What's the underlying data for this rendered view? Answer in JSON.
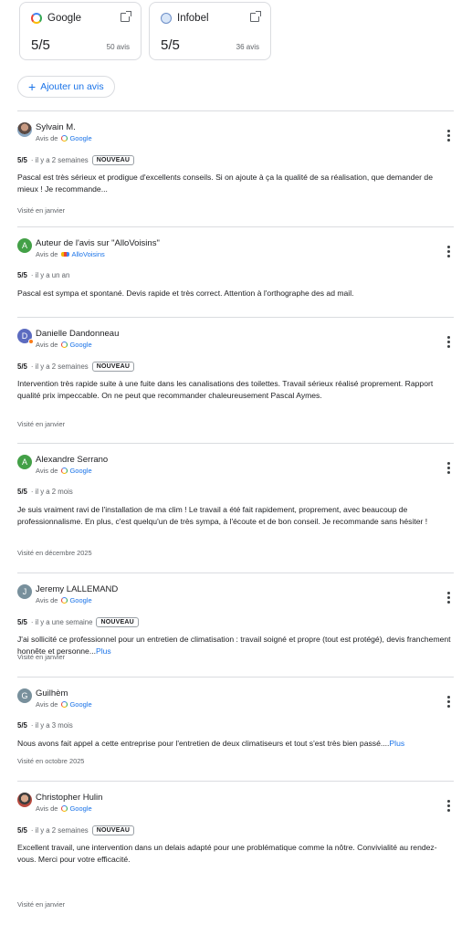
{
  "sources": [
    {
      "name": "Google",
      "logo": "google-logo",
      "score": "5/5",
      "count": "50 avis"
    },
    {
      "name": "Infobel",
      "logo": "infobel-logo",
      "score": "5/5",
      "count": "36 avis"
    }
  ],
  "add_review_label": "Ajouter un avis",
  "reviews": [
    {
      "author": "Sylvain M.",
      "avatar": "photo",
      "source_prefix": "Avis de",
      "source": "Google",
      "score": "5/5",
      "time": "· il y a 2 semaines",
      "tag": "NOUVEAU",
      "text": "Pascal est très sérieux et prodigue d'excellents conseils. Si on ajoute à ça la qualité de sa réalisation, que demander de mieux ! Je recommande...",
      "more": "",
      "visited": "Visité en janvier"
    },
    {
      "author": "Auteur de l'avis sur \"AlloVoisins\"",
      "avatar": "A",
      "avatar_color": "#43a047",
      "source_prefix": "Avis de",
      "source": "AlloVoisins",
      "score": "5/5",
      "time": "· il y a un an",
      "tag": "",
      "text": "Pascal est sympa et spontané. Devis rapide et très correct. Attention à l'orthographe des ad mail.",
      "more": "",
      "visited": ""
    },
    {
      "author": "Danielle Dandonneau",
      "avatar": "D",
      "avatar_color": "#5c6bc0",
      "source_prefix": "Avis de",
      "source": "Google",
      "score": "5/5",
      "time": "· il y a 2 semaines",
      "tag": "NOUVEAU",
      "text": "Intervention très rapide suite à une fuite dans les canalisations des toilettes. Travail sérieux réalisé proprement. Rapport qualité prix impeccable. On ne peut que recommander chaleureusement Pascal Aymes.",
      "more": "",
      "visited": "Visité en janvier"
    },
    {
      "author": "Alexandre Serrano",
      "avatar": "A",
      "avatar_color": "#43a047",
      "source_prefix": "Avis de",
      "source": "Google",
      "score": "5/5",
      "time": "· il y a 2 mois",
      "tag": "",
      "text": "Je suis vraiment ravi de l'installation de ma clim ! Le travail a été fait rapidement, proprement, avec beaucoup de professionnalisme. En plus, c'est quelqu'un de très sympa, à l'écoute et de bon conseil. Je recommande sans hésiter !",
      "more": "",
      "visited": "Visité en décembre 2025"
    },
    {
      "author": "Jeremy LALLEMAND",
      "avatar": "J",
      "avatar_color": "#78909c",
      "source_prefix": "Avis de",
      "source": "Google",
      "score": "5/5",
      "time": "· il y a une semaine",
      "tag": "NOUVEAU",
      "text": "J'ai sollicité ce professionnel pour un entretien de climatisation : travail soigné et propre (tout est protégé), devis franchement honnête et personne...",
      "more": "Plus",
      "visited": "Visité en janvier"
    },
    {
      "author": "Guilhèm",
      "avatar": "G",
      "avatar_color": "#78909c",
      "source_prefix": "Avis de",
      "source": "Google",
      "score": "5/5",
      "time": "· il y a 3 mois",
      "tag": "",
      "text": "Nous avons fait appel a cette entreprise pour l'entretien de deux climatiseurs et tout s'est très bien passé....",
      "more": "Plus",
      "visited": "Visité en octobre 2025"
    },
    {
      "author": "Christopher Hulin",
      "avatar": "photo2",
      "source_prefix": "Avis de",
      "source": "Google",
      "score": "5/5",
      "time": "· il y a 2 semaines",
      "tag": "NOUVEAU",
      "text": "Excellent travail, une intervention dans un delais adapté pour une problématique comme la nôtre. Convivialité au rendez-vous. Merci pour votre efficacité.",
      "more": "",
      "visited": "Visité en janvier"
    }
  ]
}
